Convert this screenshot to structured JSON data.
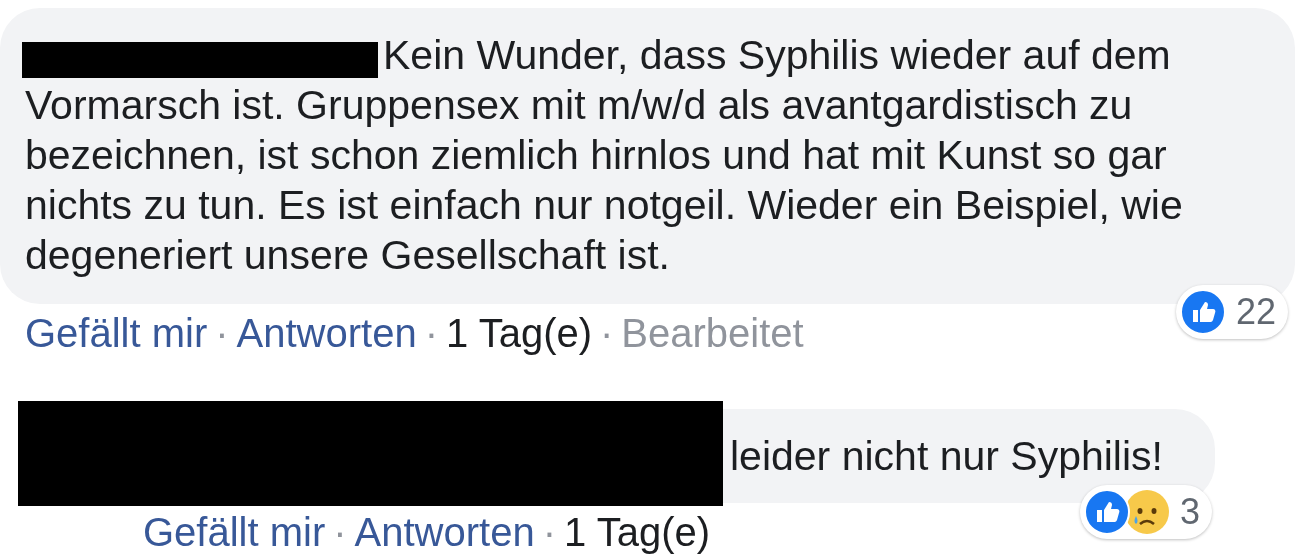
{
  "comments": [
    {
      "redacted": true,
      "text": "Kein Wunder, dass Syphilis wieder auf dem Vormarsch ist. Gruppensex mit m/w/d als avantgardistisch zu bezeichnen, ist schon ziemlich hirnlos und hat mit Kunst so gar nichts zu tun. Es ist einfach nur notgeil. Wieder ein Beispiel, wie degeneriert unsere Gesellschaft ist.",
      "reactions": {
        "types": [
          {
            "kind": "like"
          }
        ],
        "count": "22"
      },
      "separator": "·",
      "actions": [
        {
          "kind": "link",
          "label": "Gefällt mir"
        },
        {
          "kind": "link",
          "label": "Antworten"
        },
        {
          "kind": "time",
          "label": "1 Tag(e)"
        },
        {
          "kind": "meta",
          "label": "Bearbeitet"
        }
      ]
    },
    {
      "redacted": true,
      "text": "leider nicht nur Syphilis!",
      "reactions": {
        "types": [
          {
            "kind": "like"
          },
          {
            "kind": "sad"
          }
        ],
        "count": "3"
      },
      "separator": "·",
      "actions": [
        {
          "kind": "link",
          "label": "Gefällt mir"
        },
        {
          "kind": "link",
          "label": "Antworten"
        },
        {
          "kind": "time",
          "label": "1 Tag(e)"
        }
      ]
    }
  ]
}
